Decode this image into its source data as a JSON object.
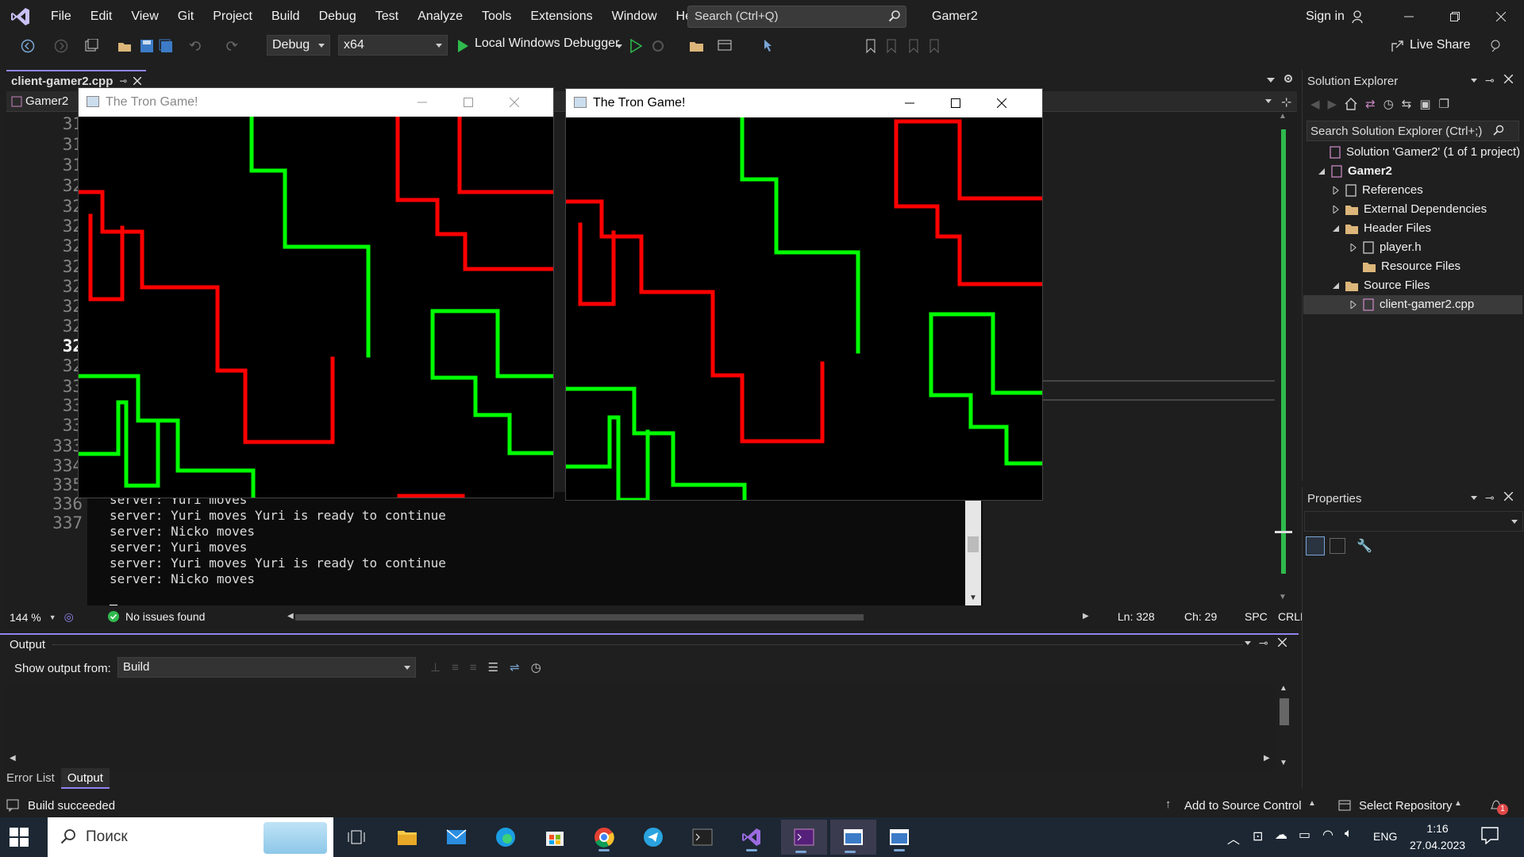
{
  "menubar": {
    "items": [
      "File",
      "Edit",
      "View",
      "Git",
      "Project",
      "Build",
      "Debug",
      "Test",
      "Analyze",
      "Tools",
      "Extensions",
      "Window",
      "Help"
    ],
    "search_placeholder": "Search (Ctrl+Q)",
    "solution_name": "Gamer2",
    "sign_in": "Sign in"
  },
  "toolbar": {
    "config": "Debug",
    "platform": "x64",
    "debugger": "Local Windows Debugger",
    "live_share": "Live Share"
  },
  "doc_tab": {
    "title": "client-gamer2.cpp",
    "scope": "Gamer2"
  },
  "editor": {
    "line_numbers": [
      "31",
      "31",
      "31",
      "32",
      "32",
      "32",
      "32",
      "32",
      "32",
      "32",
      "32",
      "32",
      "32",
      "33",
      "33",
      "33",
      "333",
      "334",
      "335",
      "336",
      "337"
    ],
    "current_line_index": 11,
    "console_lines": [
      "server: Yuri moves",
      "server: Yuri moves Yuri is ready to continue",
      "server: Nicko moves",
      "server: Yuri moves",
      "server: Yuri moves Yuri is ready to continue",
      "server: Nicko moves"
    ],
    "zoom": "144 %",
    "issues": "No issues found",
    "ln": "Ln: 328",
    "ch": "Ch: 29",
    "spc": "SPC",
    "eol": "CRLF"
  },
  "tron_windows": [
    {
      "title": "The Tron Game!",
      "active": false
    },
    {
      "title": "The Tron Game!",
      "active": true
    }
  ],
  "solution_explorer": {
    "title": "Solution Explorer",
    "search_placeholder": "Search Solution Explorer (Ctrl+;)",
    "items": [
      {
        "label": "Solution 'Gamer2' (1 of 1 project)",
        "icon": "solution-icon"
      },
      {
        "label": "Gamer2",
        "icon": "project-icon"
      },
      {
        "label": "References",
        "icon": "references-icon"
      },
      {
        "label": "External Dependencies",
        "icon": "folder-icon"
      },
      {
        "label": "Header Files",
        "icon": "folder-icon"
      },
      {
        "label": "player.h",
        "icon": "header-file-icon"
      },
      {
        "label": "Resource Files",
        "icon": "folder-icon"
      },
      {
        "label": "Source Files",
        "icon": "folder-icon"
      },
      {
        "label": "client-gamer2.cpp",
        "icon": "cpp-file-icon"
      }
    ]
  },
  "properties": {
    "title": "Properties"
  },
  "output": {
    "title": "Output",
    "show_from_label": "Show output from:",
    "source": "Build",
    "tabs": [
      "Error List",
      "Output"
    ]
  },
  "statusbar": {
    "message": "Build succeeded",
    "add_source_control": "Add to Source Control",
    "select_repo": "Select Repository",
    "notification_count": "1"
  },
  "taskbar": {
    "search_placeholder": "Поиск",
    "lang": "ENG",
    "time": "1:16",
    "date": "27.04.2023"
  },
  "colors": {
    "accent": "#9184ee",
    "player_red": "#ff0000",
    "player_green": "#00ff00"
  }
}
